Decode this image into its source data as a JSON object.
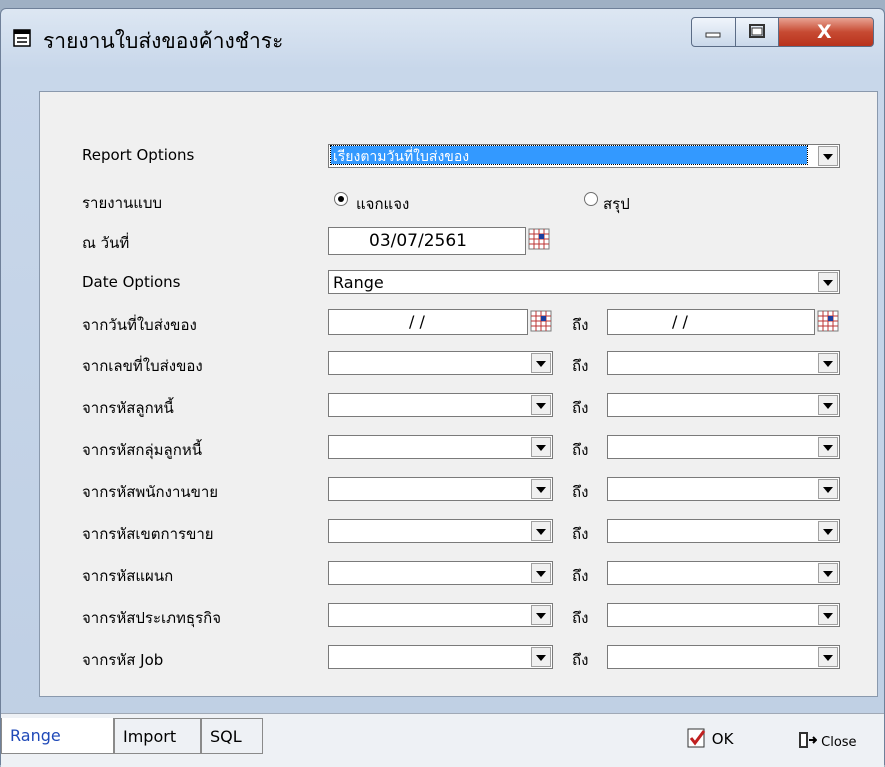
{
  "window": {
    "title": "รายงานใบส่งของค้างชำระ",
    "caption_close": "X"
  },
  "form": {
    "report_options": {
      "label": "Report Options",
      "value": "เรียงตามวันที่ใบส่งของ"
    },
    "report_type": {
      "label": "รายงานแบบ",
      "option_detail": "แจกแจง",
      "option_summary": "สรุป",
      "selected": "แจกแจง"
    },
    "as_of_date": {
      "label": "ณ วันที่",
      "value": "03/07/2561"
    },
    "date_options": {
      "label": "Date Options",
      "value": "Range"
    },
    "to_label": "ถึง",
    "rows": [
      {
        "label": "จากวันที่ใบส่งของ",
        "from": "/ /",
        "to": "/ /"
      },
      {
        "label": "จากเลขที่ใบส่งของ",
        "from": "",
        "to": ""
      },
      {
        "label": "จากรหัสลูกหนี้",
        "from": "",
        "to": ""
      },
      {
        "label": "จากรหัสกลุ่มลูกหนี้",
        "from": "",
        "to": ""
      },
      {
        "label": "จากรหัสพนักงานขาย",
        "from": "",
        "to": ""
      },
      {
        "label": "จากรหัสเขตการขาย",
        "from": "",
        "to": ""
      },
      {
        "label": "จากรหัสแผนก",
        "from": "",
        "to": ""
      },
      {
        "label": "จากรหัสประเภทธุรกิจ",
        "from": "",
        "to": ""
      },
      {
        "label": "จากรหัส Job",
        "from": "",
        "to": ""
      }
    ]
  },
  "tabs": [
    {
      "label": "Range",
      "active": true
    },
    {
      "label": "Import",
      "active": false
    },
    {
      "label": "SQL",
      "active": false
    }
  ],
  "footer": {
    "ok_label": "OK",
    "close_label": "Close"
  },
  "colors": {
    "selection": "#3399ff",
    "active_tab": "#1f49b8",
    "close_button": "#c74a32"
  }
}
